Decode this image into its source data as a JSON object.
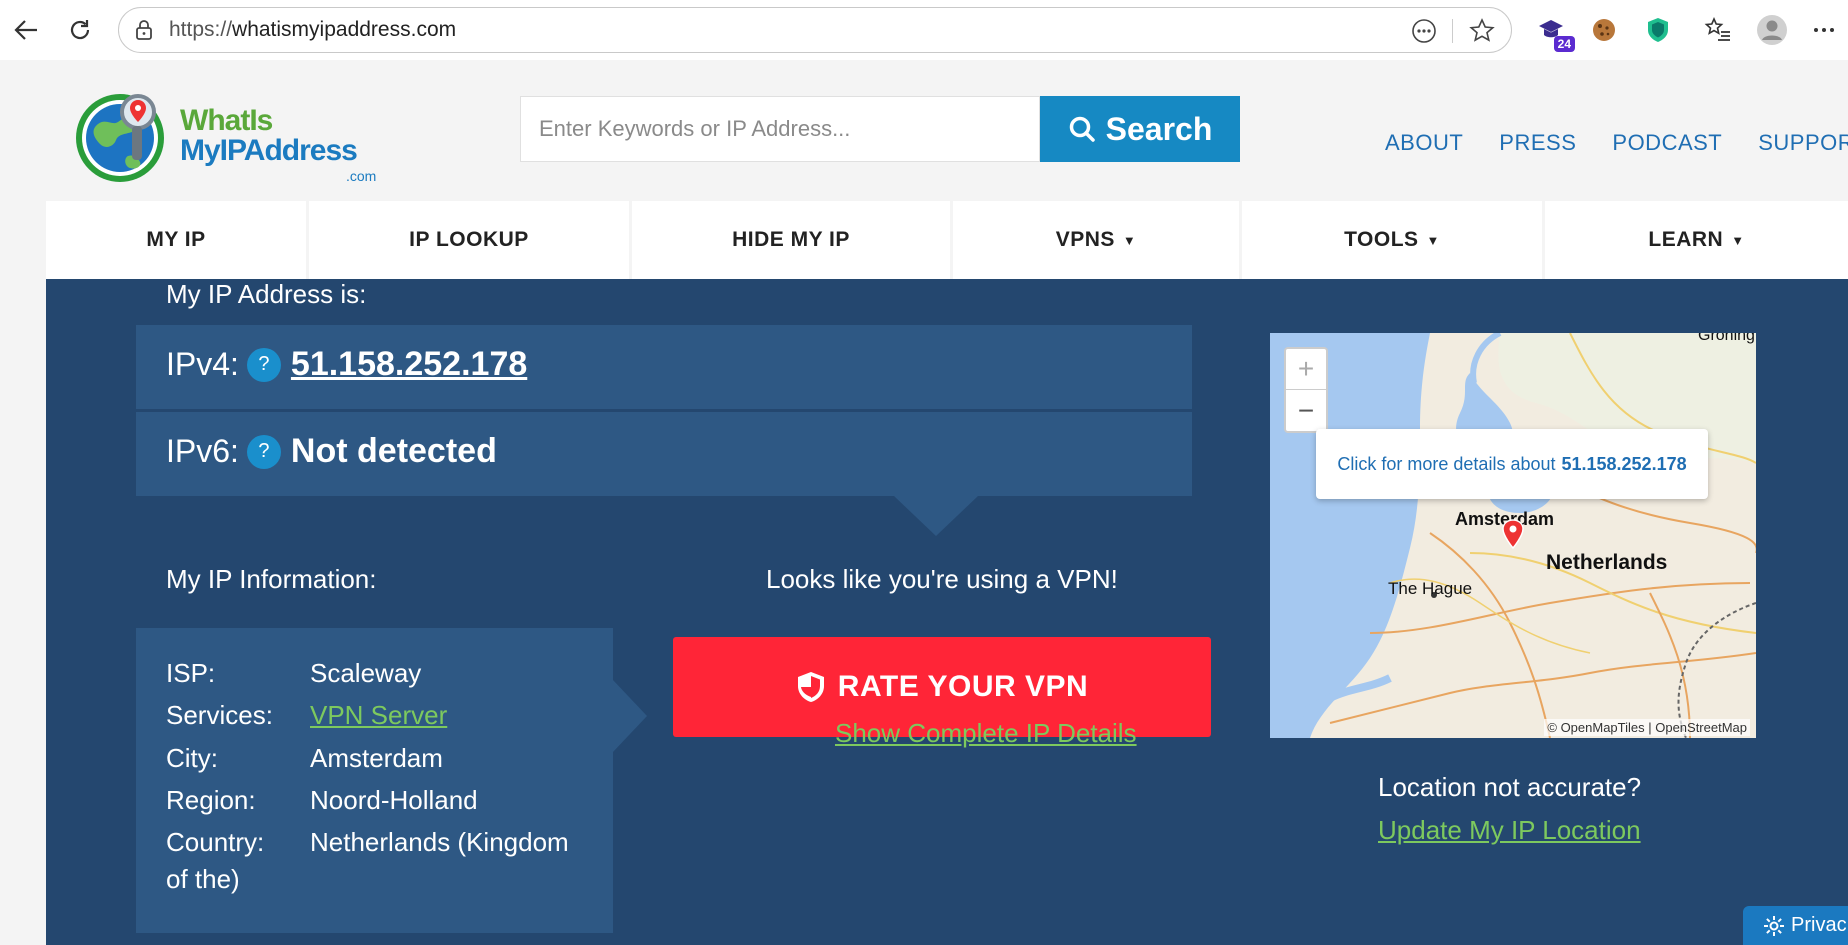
{
  "browser": {
    "url_protocol": "https://",
    "url_host": "whatismyipaddress.com",
    "extension_badge": "24"
  },
  "site": {
    "logo": {
      "line1": "WhatIs",
      "line2": "MyIPAddress",
      "line3": ".com"
    },
    "search": {
      "placeholder": "Enter Keywords or IP Address...",
      "button_label": "Search"
    },
    "top_links": [
      "ABOUT",
      "PRESS",
      "PODCAST",
      "SUPPORT"
    ],
    "nav": [
      {
        "label": "MY IP",
        "dropdown": false
      },
      {
        "label": "IP LOOKUP",
        "dropdown": false
      },
      {
        "label": "HIDE MY IP",
        "dropdown": false
      },
      {
        "label": "VPNS",
        "dropdown": true
      },
      {
        "label": "TOOLS",
        "dropdown": true
      },
      {
        "label": "LEARN",
        "dropdown": true
      }
    ]
  },
  "ip": {
    "heading": "My IP Address is:",
    "ipv4_label": "IPv4:",
    "ipv4_value": "51.158.252.178",
    "ipv6_label": "IPv6:",
    "ipv6_value": "Not detected",
    "help_glyph": "?"
  },
  "info": {
    "heading": "My IP Information:",
    "rows": {
      "isp": {
        "key": "ISP:",
        "value": "Scaleway"
      },
      "services": {
        "key": "Services:",
        "value": "VPN Server"
      },
      "city": {
        "key": "City:",
        "value": "Amsterdam"
      },
      "region": {
        "key": "Region:",
        "value": "Noord-Holland"
      },
      "country": {
        "key": "Country:",
        "value": "Netherlands (Kingdom",
        "value_cont": "of the)"
      }
    }
  },
  "vpn": {
    "notice": "Looks like you're using a VPN!",
    "rate_button": "RATE YOUR VPN",
    "details_link": "Show Complete IP Details"
  },
  "map": {
    "popup_prefix": "Click for more details about",
    "popup_ip": "51.158.252.178",
    "label_amsterdam": "Amsterdam",
    "label_netherlands": "Netherlands",
    "label_hague": "The Hague",
    "label_groningen": "Groning",
    "attribution": "© OpenMapTiles | OpenStreetMap",
    "zoom_in": "+",
    "zoom_out": "−"
  },
  "location": {
    "question": "Location not accurate?",
    "update_link": "Update My IP Location"
  },
  "privacy_button": "Privac",
  "colors": {
    "panel": "#24476f",
    "box": "#2e5884",
    "accent_blue": "#1689c3",
    "red": "#ff2537",
    "link_green": "#7dc95e"
  }
}
